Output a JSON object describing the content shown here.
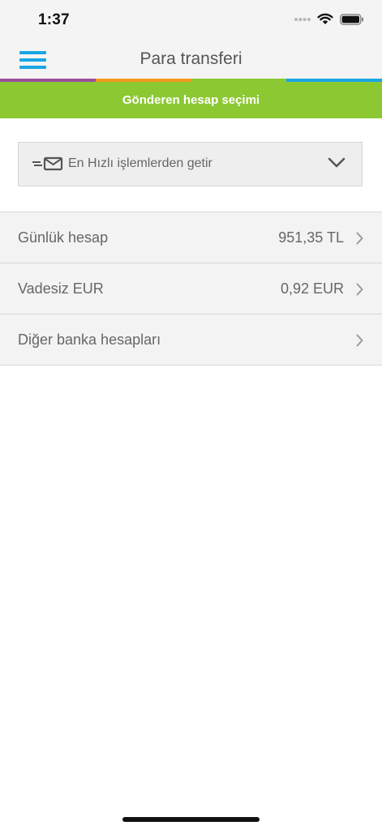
{
  "status_bar": {
    "time": "1:37"
  },
  "nav": {
    "title": "Para transferi",
    "menu_icon": "hamburger-menu-icon"
  },
  "colors": {
    "stripe": [
      "#9b4f9e",
      "#f39a1e",
      "#8cc832",
      "#1aa6e4"
    ],
    "banner": "#8cc832",
    "menu": "#1aa6e4"
  },
  "banner": {
    "text": "Gönderen hesap seçimi"
  },
  "dropdown": {
    "icon": "quick-transfer-envelope-icon",
    "label": "En Hızlı işlemlerden getir",
    "chevron": "chevron-down-icon"
  },
  "accounts": [
    {
      "name": "Günlük hesap",
      "balance": "951,35 TL"
    },
    {
      "name": "Vadesiz EUR",
      "balance": "0,92 EUR"
    },
    {
      "name": "Diğer banka hesapları",
      "balance": ""
    }
  ]
}
